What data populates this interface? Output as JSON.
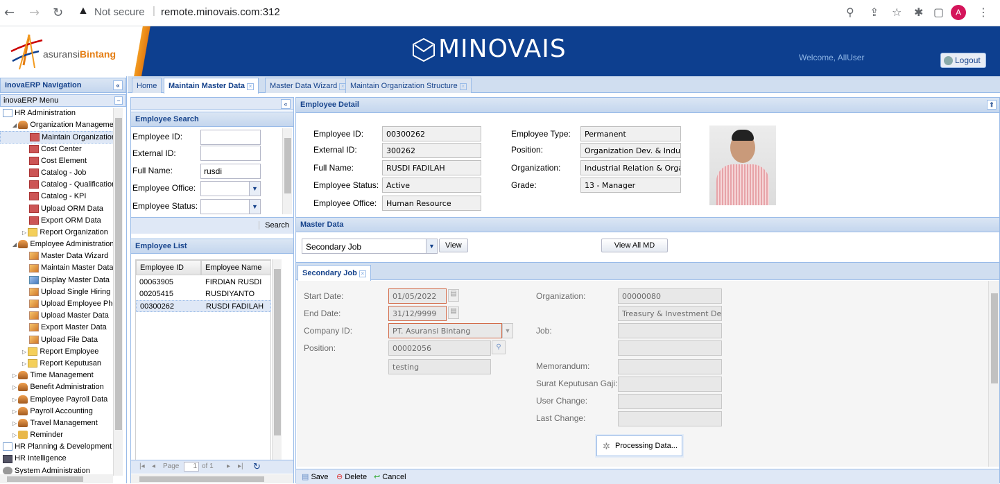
{
  "browser": {
    "security_label": "Not secure",
    "url": "remote.minovais.com:312",
    "avatar_letter": "A"
  },
  "header": {
    "logo_prefix": "asuransi",
    "logo_brand": "Bintang",
    "app_brand": "MINOVAIS",
    "welcome": "Welcome, AllUser",
    "logout": "Logout"
  },
  "nav": {
    "title": "inovaERP Navigation",
    "menu_title": "inovaERP Menu",
    "items": [
      {
        "label": "HR Administration",
        "indent": 0,
        "icon": "book"
      },
      {
        "label": "Organization Managemen",
        "indent": 1,
        "icon": "people"
      },
      {
        "label": "Maintain Organization",
        "indent": 2,
        "icon": "red-form",
        "selected": true
      },
      {
        "label": "Cost Center",
        "indent": 2,
        "icon": "red-form"
      },
      {
        "label": "Cost Element",
        "indent": 2,
        "icon": "red-form"
      },
      {
        "label": "Catalog - Job",
        "indent": 2,
        "icon": "red-form"
      },
      {
        "label": "Catalog - Qualification",
        "indent": 2,
        "icon": "red-form"
      },
      {
        "label": "Catalog - KPI",
        "indent": 2,
        "icon": "red-form"
      },
      {
        "label": "Upload ORM Data",
        "indent": 2,
        "icon": "red-form"
      },
      {
        "label": "Export ORM Data",
        "indent": 2,
        "icon": "red-form"
      },
      {
        "label": "Report Organization",
        "indent": 2,
        "icon": "folder"
      },
      {
        "label": "Employee Administration",
        "indent": 1,
        "icon": "people"
      },
      {
        "label": "Master Data Wizard",
        "indent": 2,
        "icon": "orange-form"
      },
      {
        "label": "Maintain Master Data",
        "indent": 2,
        "icon": "orange-form"
      },
      {
        "label": "Display Master Data",
        "indent": 2,
        "icon": "blue-form"
      },
      {
        "label": "Upload Single Hiring",
        "indent": 2,
        "icon": "orange-form"
      },
      {
        "label": "Upload Employee Phot",
        "indent": 2,
        "icon": "orange-form"
      },
      {
        "label": "Upload Master Data",
        "indent": 2,
        "icon": "orange-form"
      },
      {
        "label": "Export Master Data",
        "indent": 2,
        "icon": "orange-form"
      },
      {
        "label": "Upload File Data",
        "indent": 2,
        "icon": "orange-form"
      },
      {
        "label": "Report Employee",
        "indent": 2,
        "icon": "folder"
      },
      {
        "label": "Report Keputusan",
        "indent": 2,
        "icon": "folder"
      },
      {
        "label": "Time Management",
        "indent": 1,
        "icon": "people"
      },
      {
        "label": "Benefit Administration",
        "indent": 1,
        "icon": "people"
      },
      {
        "label": "Employee Payroll Data",
        "indent": 1,
        "icon": "people"
      },
      {
        "label": "Payroll Accounting",
        "indent": 1,
        "icon": "people"
      },
      {
        "label": "Travel Management",
        "indent": 1,
        "icon": "people"
      },
      {
        "label": "Reminder",
        "indent": 1,
        "icon": "broom"
      },
      {
        "label": "HR Planning & Development",
        "indent": 0,
        "icon": "book"
      },
      {
        "label": "HR Intelligence",
        "indent": 0,
        "icon": "org"
      },
      {
        "label": "System Administration",
        "indent": 0,
        "icon": "gear"
      }
    ]
  },
  "tabs": [
    {
      "label": "Home",
      "active": false
    },
    {
      "label": "Maintain Master Data",
      "active": true
    },
    {
      "label": "Master Data Wizard",
      "active": false
    },
    {
      "label": "Maintain Organization Structure",
      "active": false
    }
  ],
  "search": {
    "title": "Employee Search",
    "employee_id_label": "Employee ID:",
    "employee_id_value": "",
    "external_id_label": "External ID:",
    "external_id_value": "",
    "full_name_label": "Full Name:",
    "full_name_value": "rusdi",
    "employee_office_label": "Employee Office:",
    "employee_office_value": "",
    "employee_status_label": "Employee Status:",
    "employee_status_value": "",
    "search_button": "Search"
  },
  "employee_list": {
    "title": "Employee List",
    "columns": [
      "Employee ID",
      "Employee Name"
    ],
    "rows": [
      [
        "00063905",
        "FIRDIAN RUSDI"
      ],
      [
        "00205415",
        "RUSDIYANTO"
      ],
      [
        "00300262",
        "RUSDI FADILAH"
      ]
    ],
    "selected_row": 2,
    "pager_page_label": "Page",
    "pager_page_value": "1",
    "pager_of": "of 1"
  },
  "detail": {
    "title": "Employee Detail",
    "employee_id_label": "Employee ID:",
    "employee_id": "00300262",
    "external_id_label": "External ID:",
    "external_id": "300262",
    "full_name_label": "Full Name:",
    "full_name": "RUSDI FADILAH",
    "employee_status_label": "Employee Status:",
    "employee_status": "Active",
    "employee_office_label": "Employee Office:",
    "employee_office": "Human Resource",
    "employee_type_label": "Employee Type:",
    "employee_type": "Permanent",
    "position_label": "Position:",
    "position": "Organization Dev. & Indust",
    "organization_label": "Organization:",
    "organization": "Industrial Relation & Orgar",
    "grade_label": "Grade:",
    "grade": "13 - Manager"
  },
  "master_data": {
    "title": "Master Data",
    "selected": "Secondary Job",
    "view_button": "View",
    "view_all_button": "View All MD"
  },
  "secondary_job": {
    "tab_label": "Secondary Job",
    "start_date_label": "Start Date:",
    "start_date": "01/05/2022",
    "end_date_label": "End Date:",
    "end_date": "31/12/9999",
    "company_id_label": "Company ID:",
    "company_id": "PT. Asuransi Bintang",
    "position_label": "Position:",
    "position_code": "00002056",
    "position_text": "testing",
    "organization_label": "Organization:",
    "organization_code": "00000080",
    "organization_text": "Treasury & Investment Depa",
    "job_label": "Job:",
    "job_code": "",
    "job_text": "",
    "memorandum_label": "Memorandum:",
    "memorandum": "",
    "surat_label": "Surat Keputusan Gaji:",
    "surat": "",
    "user_change_label": "User Change:",
    "user_change": "",
    "last_change_label": "Last Change:",
    "last_change": "",
    "processing": "Processing Data..."
  },
  "toolbar": {
    "save": "Save",
    "delete": "Delete",
    "cancel": "Cancel"
  },
  "colors": {
    "header_blue": "#0d3f8f",
    "panel_border": "#99bbe8",
    "accent_orange": "#e47d12"
  }
}
